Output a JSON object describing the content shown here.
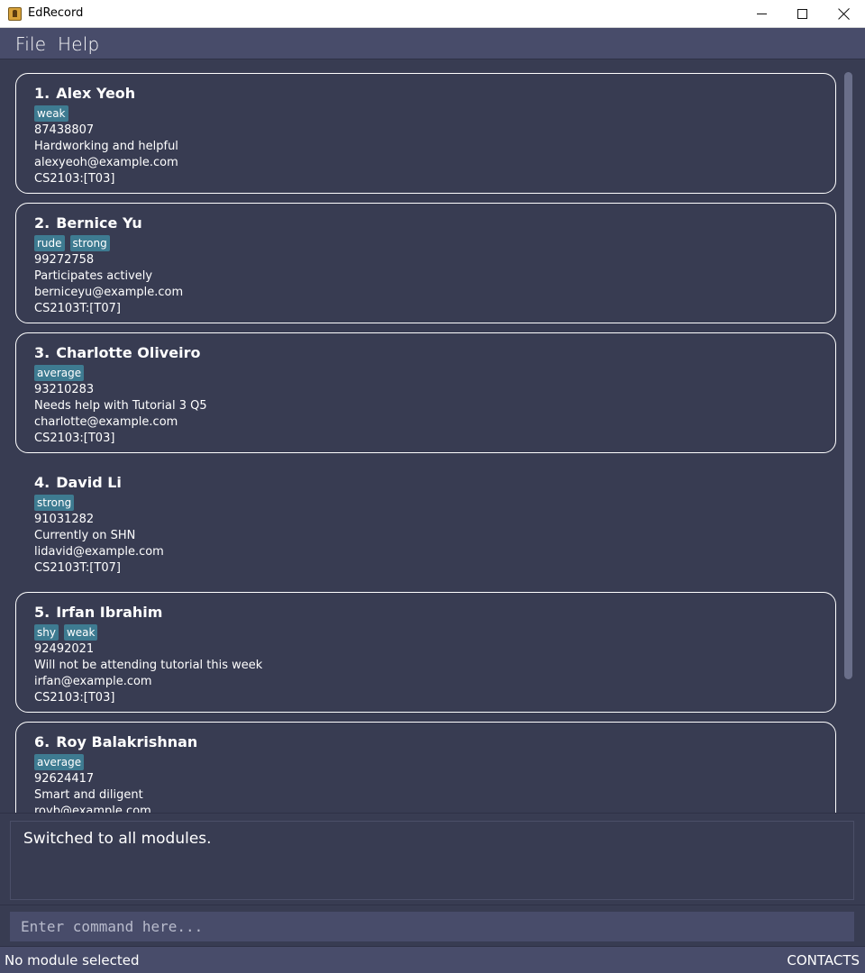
{
  "window": {
    "title": "EdRecord"
  },
  "menu": {
    "file": "File",
    "help": "Help"
  },
  "persons": [
    {
      "index": "1.",
      "name": "Alex Yeoh",
      "tags": [
        "weak"
      ],
      "phone": "87438807",
      "info": "Hardworking and helpful",
      "email": "alexyeoh@example.com",
      "module": "CS2103:[T03]"
    },
    {
      "index": "2.",
      "name": "Bernice Yu",
      "tags": [
        "rude",
        "strong"
      ],
      "phone": "99272758",
      "info": "Participates actively",
      "email": "berniceyu@example.com",
      "module": "CS2103T:[T07]"
    },
    {
      "index": "3.",
      "name": "Charlotte Oliveiro",
      "tags": [
        "average"
      ],
      "phone": "93210283",
      "info": "Needs help with Tutorial 3 Q5",
      "email": "charlotte@example.com",
      "module": "CS2103:[T03]"
    },
    {
      "index": "4.",
      "name": "David Li",
      "tags": [
        "strong"
      ],
      "phone": "91031282",
      "info": "Currently on SHN",
      "email": "lidavid@example.com",
      "module": "CS2103T:[T07]"
    },
    {
      "index": "5.",
      "name": "Irfan Ibrahim",
      "tags": [
        "shy",
        "weak"
      ],
      "phone": "92492021",
      "info": "Will not be attending tutorial this week",
      "email": "irfan@example.com",
      "module": "CS2103:[T03]"
    },
    {
      "index": "6.",
      "name": "Roy Balakrishnan",
      "tags": [
        "average"
      ],
      "phone": "92624417",
      "info": "Smart and diligent",
      "email": "royb@example.com",
      "module": ""
    }
  ],
  "result": {
    "message": "Switched to all modules."
  },
  "command": {
    "placeholder": "Enter command here...",
    "value": ""
  },
  "status": {
    "left": "No module selected",
    "right": "CONTACTS"
  }
}
